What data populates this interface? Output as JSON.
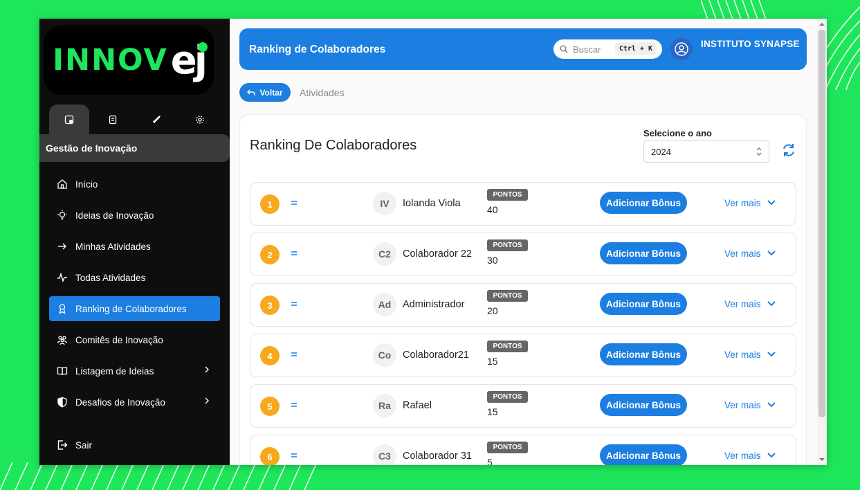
{
  "brand": {
    "logo_main": "INNOV",
    "logo_accent": "ej",
    "accent_color": "#1ee65a",
    "primary_color": "#1b7ee0"
  },
  "sidebar": {
    "icon_tabs": [
      {
        "name": "dashboard-icon",
        "active": true
      },
      {
        "name": "document-icon",
        "active": false
      },
      {
        "name": "rocket-icon",
        "active": false
      },
      {
        "name": "gear-icon",
        "active": false
      }
    ],
    "section_title": "Gestão de Inovação",
    "items": [
      {
        "label": "Início",
        "icon": "home-icon"
      },
      {
        "label": "Ideias de Inovação",
        "icon": "lightbulb-icon"
      },
      {
        "label": "Minhas Atividades",
        "icon": "arrow-right-icon"
      },
      {
        "label": "Todas Atividades",
        "icon": "activity-icon"
      },
      {
        "label": "Ranking de Colaboradores",
        "icon": "award-icon",
        "active": true
      },
      {
        "label": "Comitês de Inovação",
        "icon": "users-icon"
      },
      {
        "label": "Listagem de Ideias",
        "icon": "book-icon",
        "expandable": true
      },
      {
        "label": "Desafios de Inovação",
        "icon": "shield-icon",
        "expandable": true
      }
    ],
    "exit_label": "Sair"
  },
  "header": {
    "title": "Ranking de Colaboradores",
    "search_placeholder": "Buscar",
    "search_shortcut": "Ctrl + K",
    "org_name": "INSTITUTO SYNAPSE"
  },
  "nav": {
    "back_label": "Voltar",
    "breadcrumb": "Atividades"
  },
  "ranking": {
    "title": "Ranking De Colaboradores",
    "year_label": "Selecione o ano",
    "year_value": "2024",
    "points_label": "PONTOS",
    "bonus_label": "Adicionar Bônus",
    "more_label": "Ver mais",
    "rows": [
      {
        "rank": "1",
        "initials": "IV",
        "name": "Iolanda Viola",
        "points": "40"
      },
      {
        "rank": "2",
        "initials": "C2",
        "name": "Colaborador 22",
        "points": "30"
      },
      {
        "rank": "3",
        "initials": "Ad",
        "name": "Administrador",
        "points": "20"
      },
      {
        "rank": "4",
        "initials": "Co",
        "name": "Colaborador21",
        "points": "15"
      },
      {
        "rank": "5",
        "initials": "Ra",
        "name": "Rafael",
        "points": "15"
      },
      {
        "rank": "6",
        "initials": "C3",
        "name": "Colaborador 31",
        "points": "5"
      }
    ]
  }
}
